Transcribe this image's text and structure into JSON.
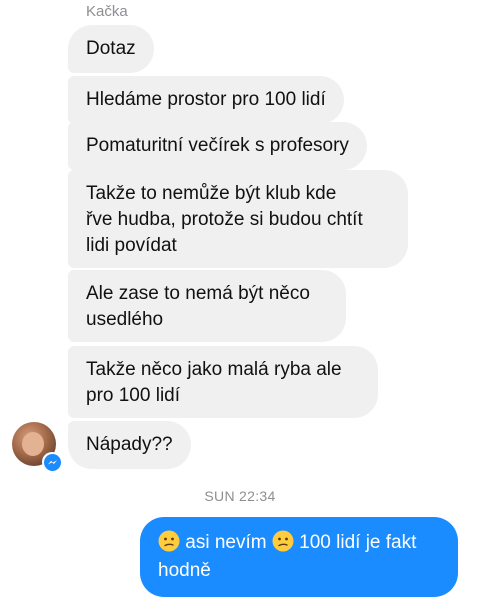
{
  "conversation": {
    "sender_name": "Kačka",
    "incoming_messages": [
      "Dotaz",
      "Hledáme prostor pro 100 lidí",
      "Pomaturitní večírek s profesory",
      "Takže to nemůže být klub kde\nřve hudba, protože si budou chtít\nlidi povídat",
      "Ale zase to nemá být něco\nusedlého",
      "Takže něco jako malá ryba ale\npro 100 lidí",
      "Nápady??"
    ],
    "timestamp": "SUN 22:34",
    "outgoing_message": {
      "part1": "asi nevím",
      "part2": "100 lidí je fakt",
      "part3": "hodně"
    }
  },
  "icons": {
    "avatar": "profile-photo",
    "badge": "messenger-icon",
    "emoji": "confused-face-icon"
  },
  "colors": {
    "incoming_bubble": "#f0f0f0",
    "outgoing_bubble": "#1a8cff",
    "meta_text": "#8e8e93"
  }
}
